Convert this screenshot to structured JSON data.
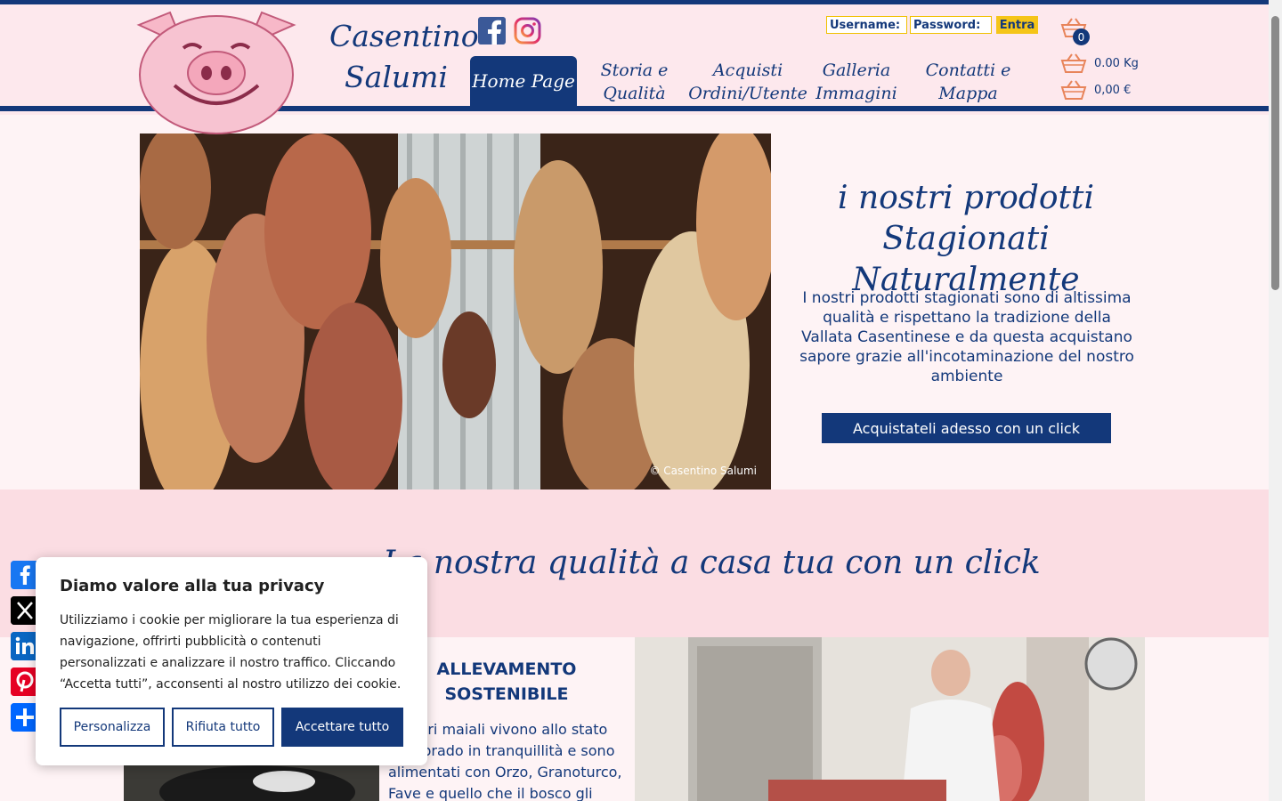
{
  "header": {
    "brand_line1": "Casentino",
    "brand_line2": "Salumi",
    "nav": [
      {
        "line1": "Home Page",
        "line2": ""
      },
      {
        "line1": "Storia e",
        "line2": "Qualità"
      },
      {
        "line1": "Acquisti",
        "line2": "Ordini/Utente"
      },
      {
        "line1": "Galleria",
        "line2": "Immagini"
      },
      {
        "line1": "Contatti e",
        "line2": "Mappa"
      }
    ],
    "login": {
      "username_label": "Username:",
      "password_label": "Password:",
      "submit": "Entra"
    },
    "cart": {
      "count": "0",
      "weight": "0.00 Kg",
      "total": "0,00 €"
    }
  },
  "hero": {
    "title": "i nostri prodotti Stagionati Naturalmente",
    "text": "I nostri prodotti stagionati sono di altissima qualità e rispettano la tradizione della Vallata Casentinese e da questa acquistano sapore grazie all'incotaminazione del nostro ambiente",
    "button": "Acquistateli adesso con un click",
    "photo_caption": "© Casentino Salumi"
  },
  "section": {
    "title": "La nostra qualità a casa tua con un click",
    "feature_title": "ALLEVAMENTO SOSTENIBILE",
    "feature_text": "I nostri maiali vivono allo stato semibrado in tranquillità e sono alimentati con Orzo, Granoturco, Fave e quello che il bosco gli"
  },
  "share": [
    "Facebook",
    "X",
    "LinkedIn",
    "Pinterest",
    "Share"
  ],
  "cookie": {
    "title": "Diamo valore alla tua privacy",
    "text": "Utilizziamo i cookie per migliorare la tua esperienza di navigazione, offrirti pubblicità o contenuti personalizzati e analizzare il nostro traffico. Cliccando “Accetta tutti”, acconsenti al nostro utilizzo dei cookie.",
    "customize": "Personalizza",
    "reject": "Rifiuta tutto",
    "accept": "Accettare tutto"
  },
  "colors": {
    "navy": "#13387a",
    "pink_bg": "#fde8ed",
    "accent_yellow": "#f5c518"
  }
}
